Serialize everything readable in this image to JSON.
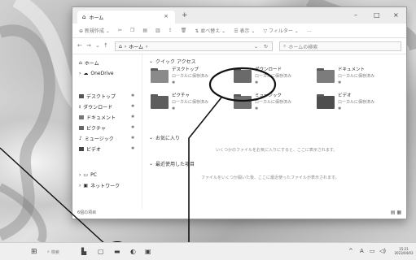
{
  "window": {
    "tab_title": "ホーム",
    "tab_close": "×",
    "new_tab": "+",
    "controls": [
      "–",
      "□",
      "×"
    ]
  },
  "commandbar": {
    "new_label": "新規作成",
    "sort_label": "並べ替え",
    "view_label": "表示",
    "filter_label": "フィルター",
    "more": "…"
  },
  "address": {
    "path": "ホーム",
    "search_placeholder": "ホームの検索"
  },
  "sidebar": {
    "home": "ホーム",
    "onedrive": "OneDrive",
    "quick": [
      {
        "label": "デスクトップ",
        "pin": "📌"
      },
      {
        "label": "ダウンロード",
        "pin": "📌"
      },
      {
        "label": "ドキュメント",
        "pin": "📌"
      },
      {
        "label": "ピクチャ",
        "pin": "📌"
      },
      {
        "label": "ミュージック",
        "pin": "📌"
      },
      {
        "label": "ビデオ",
        "pin": "📌"
      }
    ],
    "pc": "PC",
    "network": "ネットワーク"
  },
  "content": {
    "quick_access": "クイック アクセス",
    "favorites": "お気に入り",
    "recent": "最近使用した項目",
    "favorites_empty": "いくつかのファイルをお気に入りにすると、ここに表示されます。",
    "recent_empty": "ファイルをいくつか開いた後、ここに最近使ったファイルが表示されます。",
    "tiles": [
      {
        "name": "デスクトップ",
        "sub": "ローカルに保存済み"
      },
      {
        "name": "ダウンロード",
        "sub": "ローカルに保存済み"
      },
      {
        "name": "ドキュメント",
        "sub": "ローカルに保存済み"
      },
      {
        "name": "ピクチャ",
        "sub": "ローカルに保存済み"
      },
      {
        "name": "ミュージック",
        "sub": "ローカルに保存済み"
      },
      {
        "name": "ビデオ",
        "sub": "ローカルに保存済み"
      }
    ]
  },
  "status": {
    "item_count": "6個の項目"
  },
  "taskbar": {
    "search": "検索",
    "tray_caret": "^",
    "ime": "A",
    "time": "15:21",
    "date": "2023/04/03"
  }
}
